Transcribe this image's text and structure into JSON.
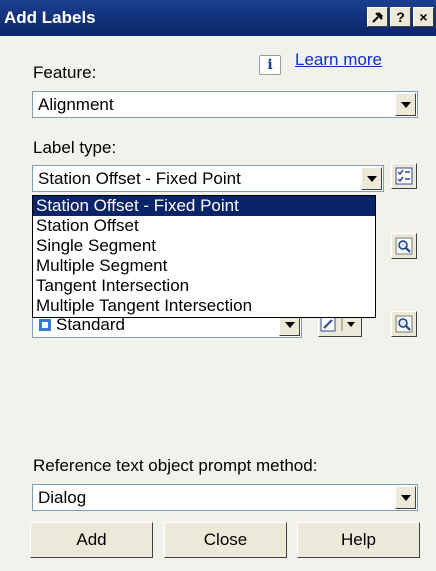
{
  "window": {
    "title": "Add Labels",
    "help_button": "?",
    "close_button": "×"
  },
  "feature": {
    "label": "Feature:",
    "value": "Alignment"
  },
  "learn_more": "Learn more",
  "info_icon_glyph": "i",
  "label_type": {
    "label": "Label type:",
    "value": "Station Offset - Fixed Point",
    "options": [
      "Station Offset - Fixed Point",
      "Station Offset",
      "Single Segment",
      "Multiple Segment",
      "Tangent Intersection",
      "Multiple Tangent Intersection"
    ],
    "selected_index": 0
  },
  "style_combo": {
    "value": "Standard"
  },
  "reference": {
    "label": "Reference text object prompt method:",
    "value": "Dialog"
  },
  "buttons": {
    "add": "Add",
    "close": "Close",
    "help": "Help"
  },
  "icons": {
    "pin": "pin-icon",
    "info": "info-icon",
    "browse": "browse-icon",
    "magnifier": "magnifier-icon",
    "style": "style-icon",
    "edit": "edit-icon"
  },
  "colors": {
    "titlebar": "#0a246a",
    "selection": "#0a246a",
    "link": "#1030c8",
    "dialog_bg": "#f2f2ec"
  }
}
